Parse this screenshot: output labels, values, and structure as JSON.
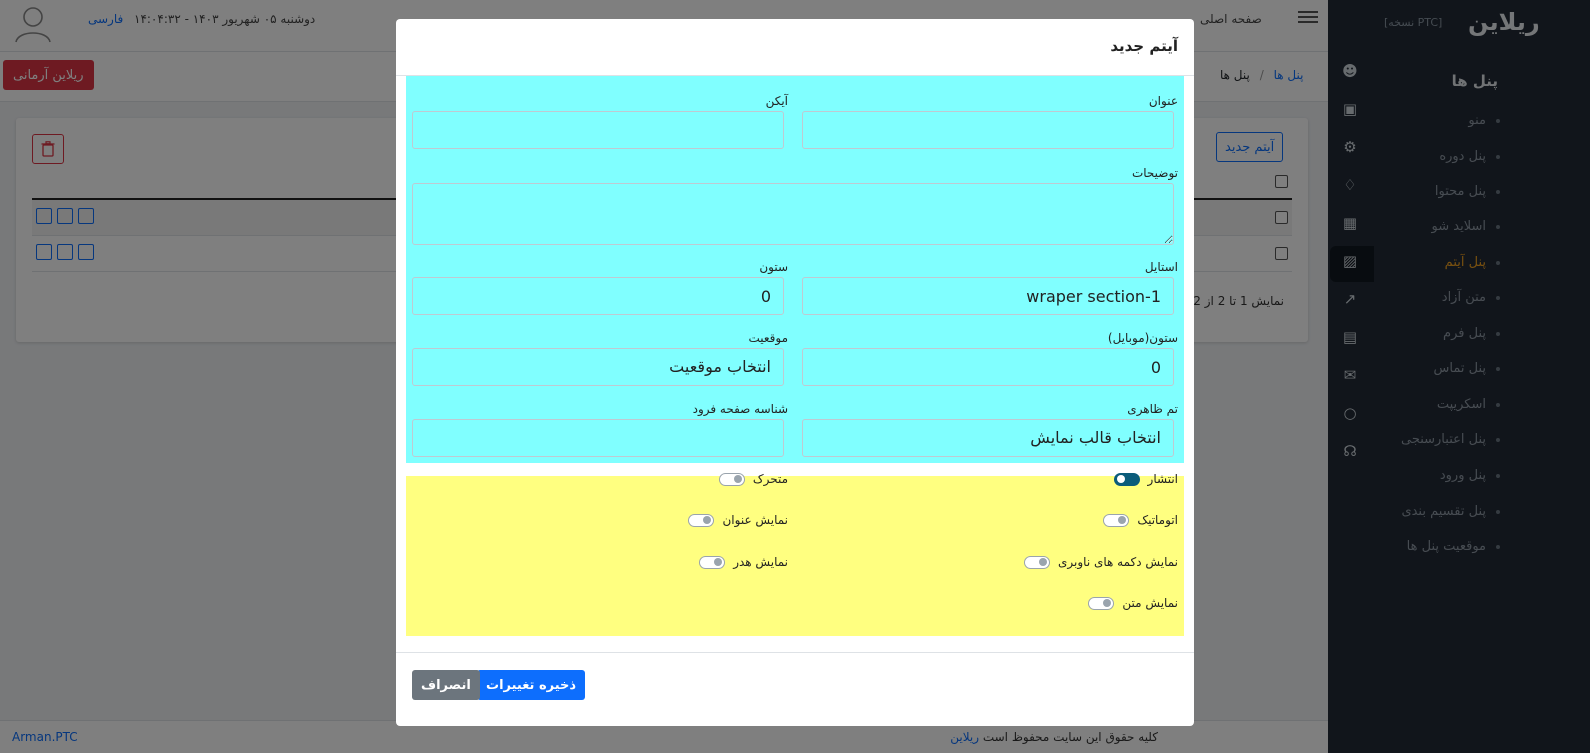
{
  "topbar": {
    "language": "فارسی",
    "datetime": "دوشنبه ۰۵ شهریور ۱۴۰۳ - ۱۴:۰۴:۳۲",
    "home_link": "صفحه اصلی"
  },
  "subbar": {
    "user_button": "ریلاین آرمانی",
    "breadcrumb": {
      "current": "پنل ها",
      "separator": "/",
      "link": "پنل ها"
    }
  },
  "card": {
    "new_item_button": "آیتم جدید",
    "paging_text": "نمایش 1 تا 2 از 2"
  },
  "footer": {
    "left_text": "Arman.PTC",
    "copyright_prefix": "کلیه حقوق این سایت محفوظ است",
    "brand_link": "ریلاین"
  },
  "sidebar": {
    "logo": "ریلاین",
    "version_tag": "[نسخه PTC]",
    "section_title": "پنل ها",
    "items": [
      {
        "label": "منو"
      },
      {
        "label": "پنل دوره"
      },
      {
        "label": "پنل محتوا"
      },
      {
        "label": "اسلاید شو"
      },
      {
        "label": "پنل آیتم"
      },
      {
        "label": "متن آزاد"
      },
      {
        "label": "پنل فرم"
      },
      {
        "label": "پنل تماس"
      },
      {
        "label": "اسکریپت"
      },
      {
        "label": "پنل اعتبارسنجی"
      },
      {
        "label": "پنل ورود"
      },
      {
        "label": "پنل تقسیم بندی"
      },
      {
        "label": "موقعیت پنل ها"
      }
    ],
    "active_item": "پنل آیتم"
  },
  "modal": {
    "title": "آیتم جدید",
    "fields": {
      "title_label": "عنوان",
      "title_value": "",
      "icon_label": "آیکن",
      "icon_value": "",
      "description_label": "توضیحات",
      "style_label": "استایل",
      "style_value": "wraper section-1",
      "column_label": "ستون",
      "column_value": "0",
      "mobile_column_label": "ستون(موبایل)",
      "mobile_column_value": "0",
      "position_label": "موقعیت",
      "position_value": "انتخاب موقعیت",
      "theme_label": "تم ظاهری",
      "theme_value": "انتخاب قالب نمایش",
      "landing_id_label": "شناسه صفحه فرود",
      "landing_id_value": ""
    },
    "toggles": {
      "publish": {
        "label": "انتشار",
        "on": true
      },
      "moving": {
        "label": "متحرک",
        "on": false
      },
      "automatic": {
        "label": "اتوماتیک",
        "on": false
      },
      "show_title": {
        "label": "نمایش عنوان",
        "on": false
      },
      "show_nav_buttons": {
        "label": "نمایش دکمه های ناوبری",
        "on": false
      },
      "show_header": {
        "label": "نمایش هدر",
        "on": false
      },
      "show_text": {
        "label": "نمایش متن",
        "on": false
      }
    },
    "save_button": "ذخیره تغییرات",
    "cancel_button": "انصراف"
  },
  "colors": {
    "primary": "#0d6efd",
    "danger": "#dc3545",
    "sidebar_bg": "#222b36",
    "active_item": "#f0a020",
    "cyan_panel": "#80ffff",
    "yellow_panel": "#ffff80"
  }
}
